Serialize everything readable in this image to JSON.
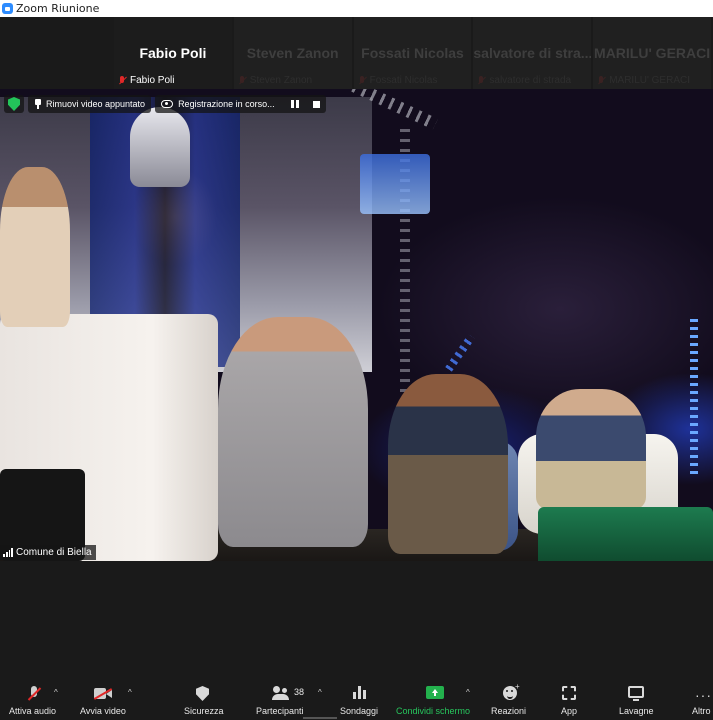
{
  "window": {
    "title": "Zoom Riunione"
  },
  "participants": [
    {
      "name": "Fabio Poli",
      "label": "Fabio Poli",
      "active": true
    },
    {
      "name": "Steven Zanon",
      "label": "Steven Zanon",
      "active": false
    },
    {
      "name": "Fossati Nicolas",
      "label": "Fossati Nicolas",
      "active": false
    },
    {
      "name": "salvatore di stra...",
      "label": "salvatore di strada",
      "active": false
    },
    {
      "name": "MARILU' GERACI",
      "label": "MARILU' GERACI",
      "active": false
    }
  ],
  "video": {
    "unpin_label": "Rimuovi video appuntato",
    "recording_label": "Registrazione in corso...",
    "speaker_name": "Comune di Biella"
  },
  "toolbar": {
    "audio": "Attiva audio",
    "video": "Avvia video",
    "security": "Sicurezza",
    "participants": "Partecipanti",
    "participants_count": "38",
    "polls": "Sondaggi",
    "share": "Condividi schermo",
    "reactions": "Reazioni",
    "apps": "App",
    "whiteboards": "Lavagne",
    "more": "Altro"
  },
  "colors": {
    "accent_green": "#23b14d",
    "muted_red": "#e02828",
    "zoom_blue": "#2d8cff"
  }
}
